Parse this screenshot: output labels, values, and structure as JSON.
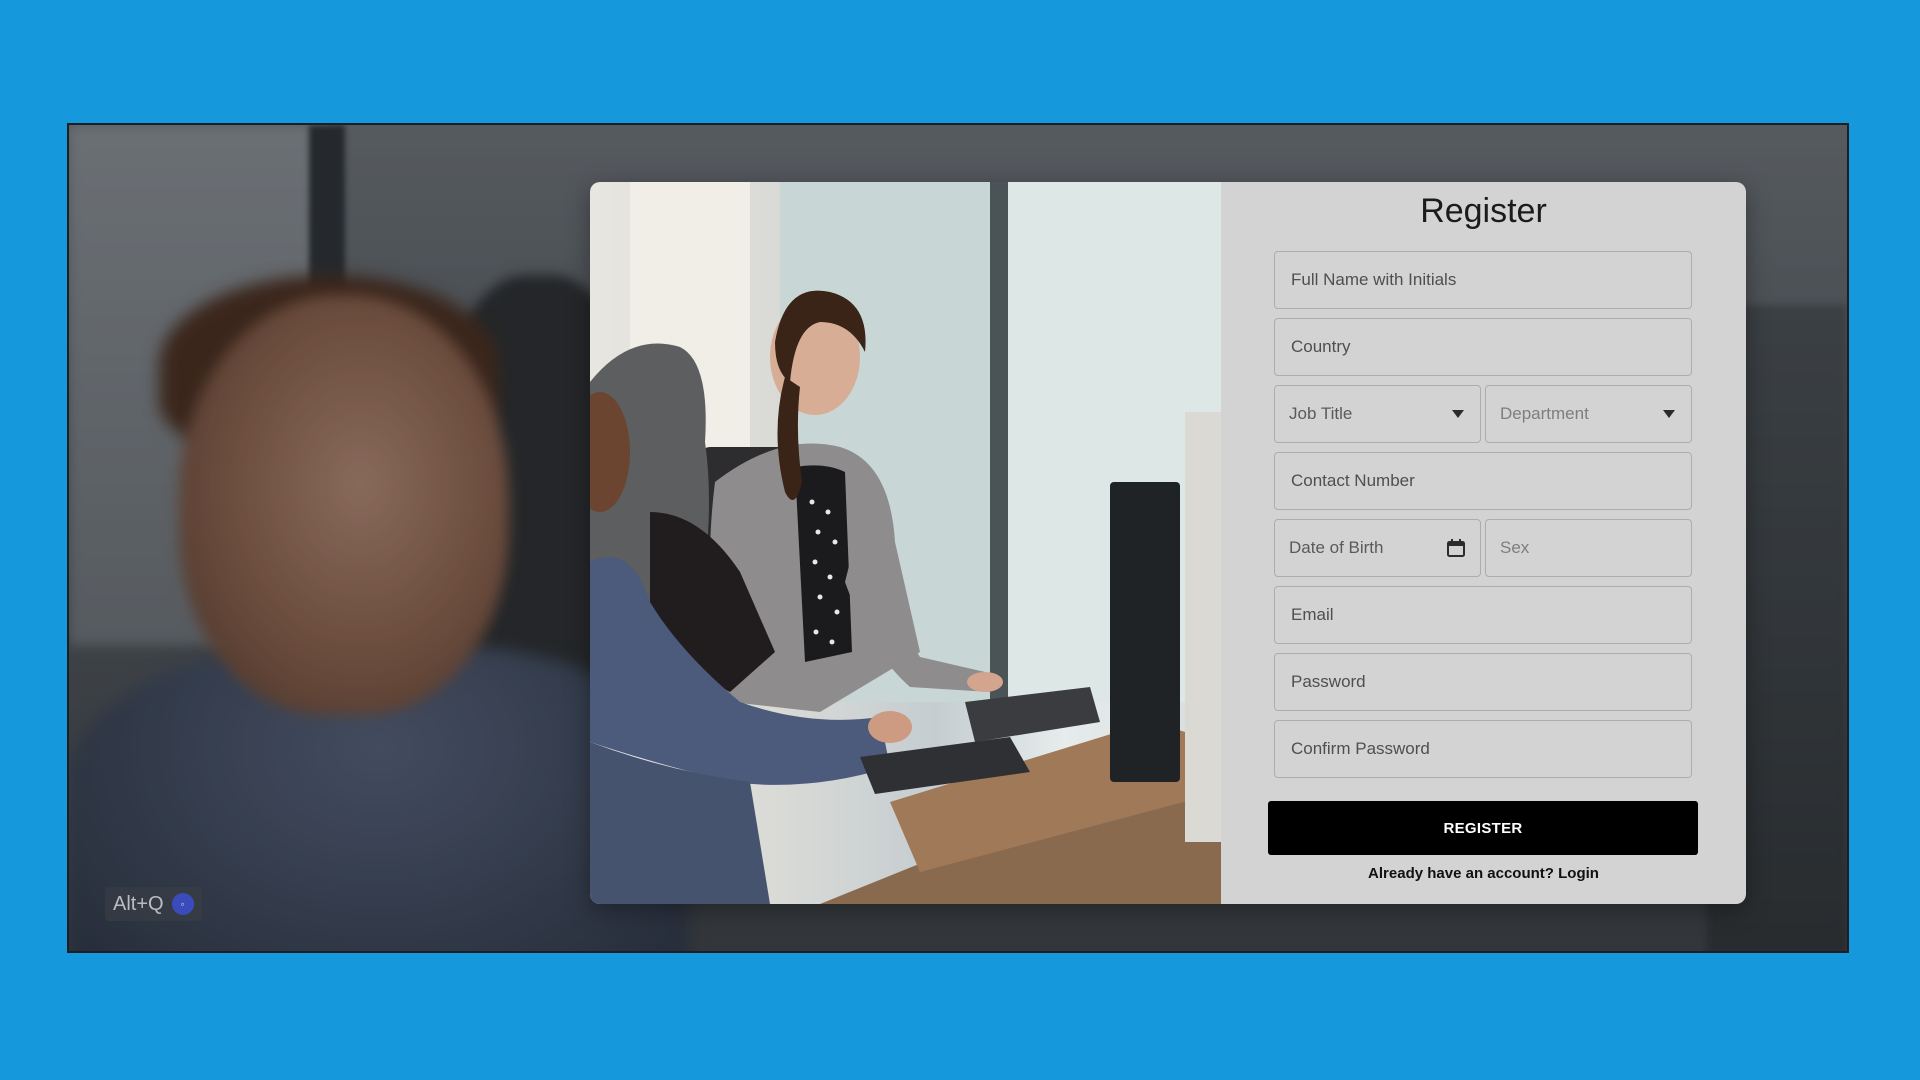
{
  "overlay": {
    "shortcut_label": "Alt+Q"
  },
  "form": {
    "title": "Register",
    "fields": {
      "full_name": {
        "placeholder": "Full Name with Initials"
      },
      "country": {
        "placeholder": "Country"
      },
      "job_title": {
        "placeholder": "Job Title"
      },
      "department": {
        "placeholder": "Department"
      },
      "contact_number": {
        "placeholder": "Contact Number"
      },
      "date_of_birth": {
        "placeholder": "Date of Birth"
      },
      "sex": {
        "placeholder": "Sex"
      },
      "email": {
        "placeholder": "Email"
      },
      "password": {
        "placeholder": "Password"
      },
      "confirm_password": {
        "placeholder": "Confirm Password"
      }
    },
    "submit_label": "REGISTER",
    "login_prompt": "Already have an account?",
    "login_link": "Login"
  },
  "colors": {
    "page_background": "#1599dc",
    "form_panel": "#d3d3d3",
    "button": "#000000",
    "button_text": "#ffffff"
  },
  "icons": {
    "job_title_dropdown": "chevron-down-icon",
    "department_dropdown": "chevron-down-icon",
    "date_of_birth": "calendar-icon"
  }
}
